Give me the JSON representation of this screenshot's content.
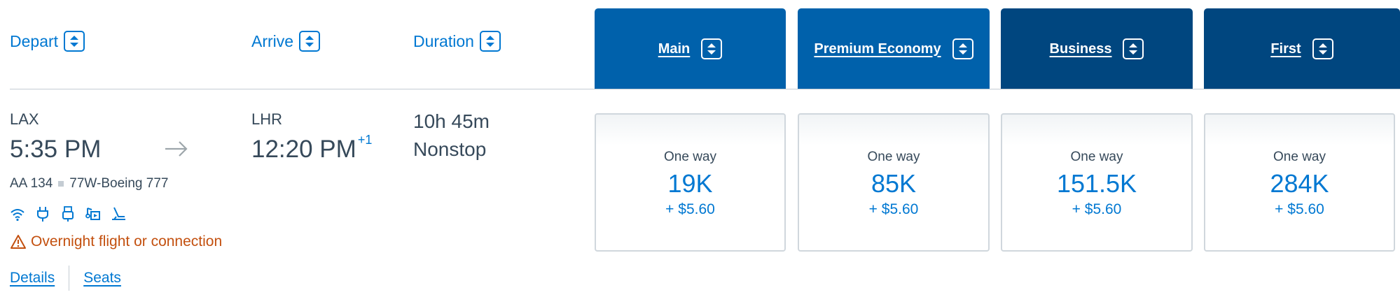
{
  "columns": {
    "depart": "Depart",
    "arrive": "Arrive",
    "duration": "Duration"
  },
  "cabins": [
    {
      "label": "Main",
      "color": "#0061ab"
    },
    {
      "label": "Premium Economy",
      "color": "#0061ab"
    },
    {
      "label": "Business",
      "color": "#00467f"
    },
    {
      "label": "First",
      "color": "#00467f"
    }
  ],
  "flight": {
    "origin": "LAX",
    "depart_time": "5:35 PM",
    "destination": "LHR",
    "arrive_time": "12:20 PM",
    "day_offset": "+1",
    "duration": "10h 45m",
    "stops": "Nonstop",
    "flight_number": "AA 134",
    "aircraft": "77W-Boeing 777",
    "amenity_icons": [
      "wifi-icon",
      "power-outlet-icon",
      "usb-icon",
      "entertainment-icon",
      "lie-flat-seat-icon"
    ],
    "warning": "Overnight flight or connection",
    "warning_color": "#c3500f",
    "links": {
      "details": "Details",
      "seats": "Seats"
    }
  },
  "fares": [
    {
      "label": "One way",
      "miles": "19K",
      "tax": "+ $5.60"
    },
    {
      "label": "One way",
      "miles": "85K",
      "tax": "+ $5.60"
    },
    {
      "label": "One way",
      "miles": "151.5K",
      "tax": "+ $5.60"
    },
    {
      "label": "One way",
      "miles": "284K",
      "tax": "+ $5.60"
    }
  ],
  "colors": {
    "accent": "#0078d2",
    "text": "#36495a"
  }
}
